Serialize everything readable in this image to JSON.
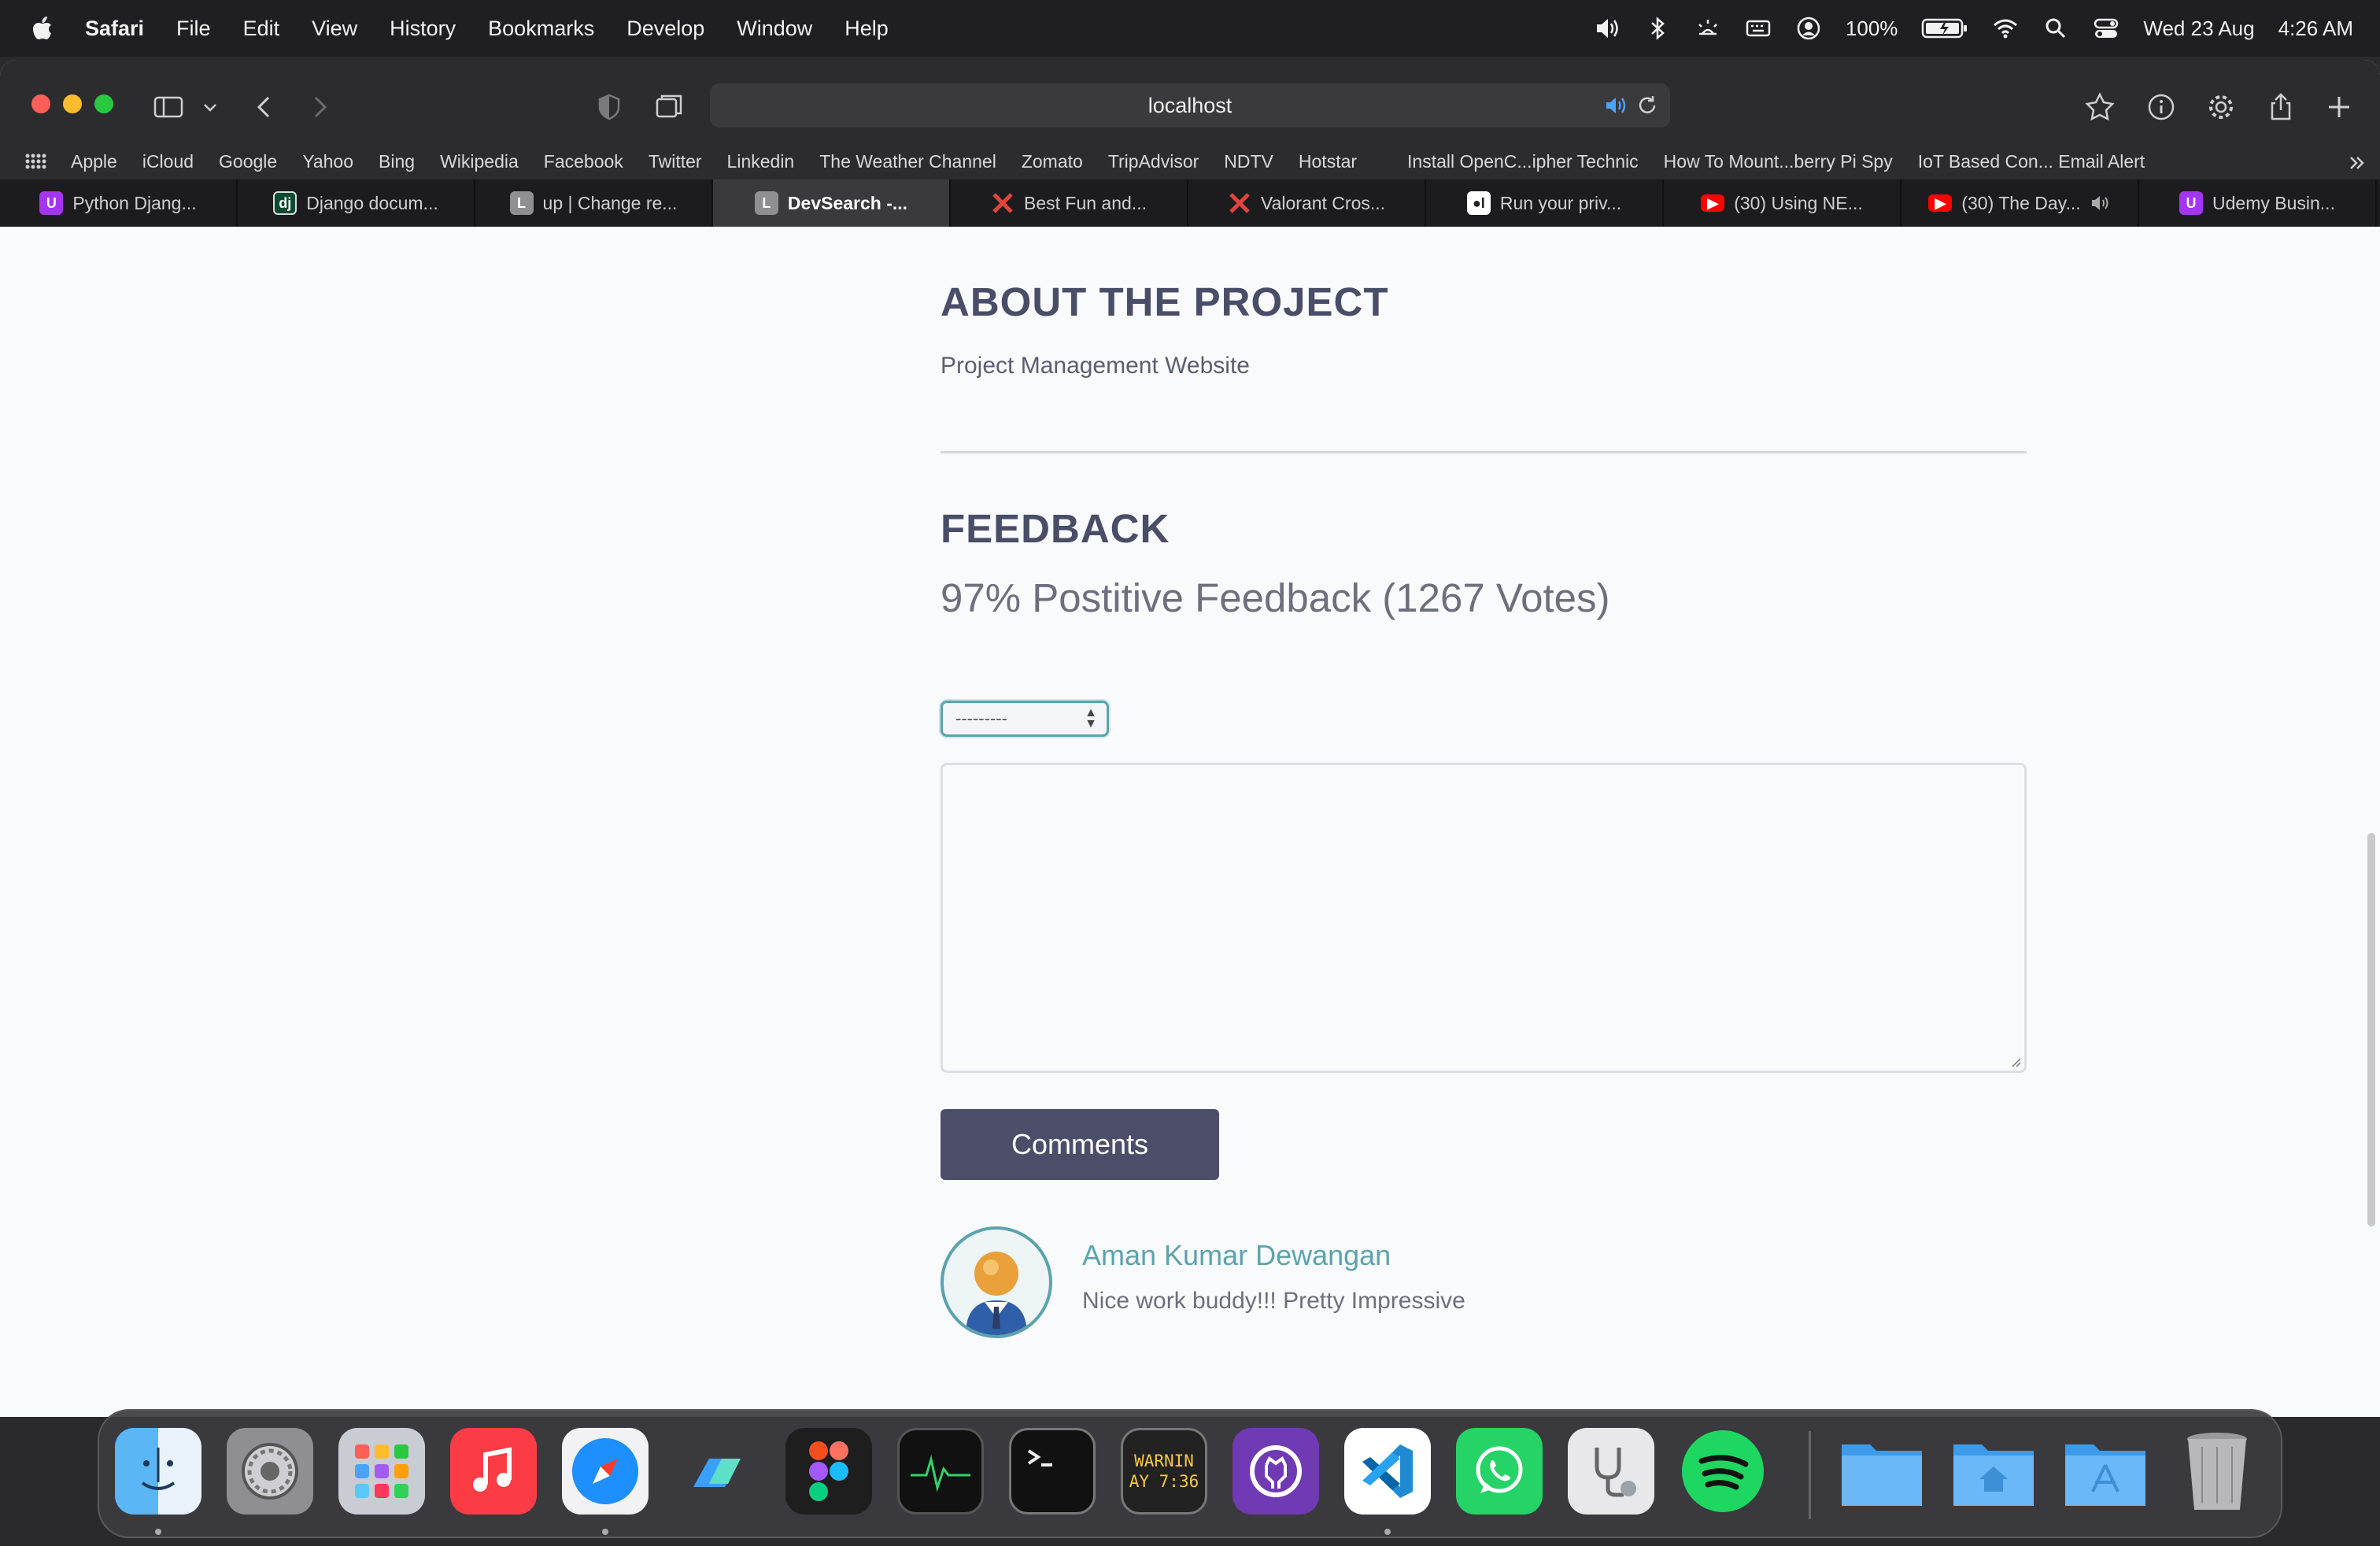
{
  "menubar": {
    "app_name": "Safari",
    "items": [
      "File",
      "Edit",
      "View",
      "History",
      "Bookmarks",
      "Develop",
      "Window",
      "Help"
    ],
    "battery": "100%",
    "date": "Wed 23 Aug",
    "time": "4:26 AM"
  },
  "browser": {
    "url": "localhost",
    "bookmarks": [
      "Apple",
      "iCloud",
      "Google",
      "Yahoo",
      "Bing",
      "Wikipedia",
      "Facebook",
      "Twitter",
      "Linkedin",
      "The Weather Channel",
      "Zomato",
      "TripAdvisor",
      "NDTV",
      "Hotstar",
      "Install OpenC...ipher Technic",
      "How To Mount...berry Pi Spy",
      "IoT Based Con... Email Alert"
    ],
    "tabs": [
      {
        "title": "Python Djang...",
        "favicon": "udemy-icon",
        "color": "#a435f0"
      },
      {
        "title": "Django docum...",
        "favicon": "django-icon",
        "color": "#0c4b33"
      },
      {
        "title": "up | Change re...",
        "favicon": "letter-l-icon",
        "color": "#8e8e93"
      },
      {
        "title": "DevSearch -...",
        "favicon": "letter-l-icon",
        "color": "#8e8e93"
      },
      {
        "title": "Best Fun and...",
        "favicon": "cross-swords-icon",
        "color": "#e0443c"
      },
      {
        "title": "Valorant Cros...",
        "favicon": "cross-swords-icon",
        "color": "#e0443c"
      },
      {
        "title": "Run your priv...",
        "favicon": "medium-icon",
        "color": "#222222"
      },
      {
        "title": "(30) Using NE...",
        "favicon": "youtube-icon",
        "color": "#ff0000"
      },
      {
        "title": "(30) The Day...",
        "favicon": "youtube-icon",
        "color": "#ff0000"
      },
      {
        "title": "Udemy Busin...",
        "favicon": "udemy-icon",
        "color": "#a435f0"
      }
    ],
    "active_tab_index": 3
  },
  "about": {
    "title": "ABOUT THE PROJECT",
    "text": "Project Management Website"
  },
  "feedback": {
    "title": "FEEDBACK",
    "stats": "97% Postitive Feedback (1267 Votes)",
    "select_value": "---------",
    "comment_value": "",
    "submit_label": "Comments"
  },
  "review": {
    "name": "Aman Kumar Dewangan",
    "text": "Nice work buddy!!! Pretty Impressive"
  },
  "dock": {
    "apps": [
      "finder-icon",
      "system-settings-icon",
      "launchpad-icon",
      "music-icon",
      "safari-icon",
      "app-icon",
      "figma-icon",
      "activity-monitor-icon",
      "terminal-icon",
      "console-icon",
      "github-desktop-icon",
      "vscode-icon",
      "whatsapp-icon",
      "disk-utility-icon",
      "spotify-icon",
      "folder-icon",
      "home-folder-icon",
      "applications-folder-icon",
      "trash-icon"
    ],
    "console_text_1": "WARNIN",
    "console_text_2": "AY 7:36"
  },
  "colors": {
    "accent": "#5ba3ad",
    "primary": "#4c4e69",
    "heading": "#4a4d67"
  }
}
